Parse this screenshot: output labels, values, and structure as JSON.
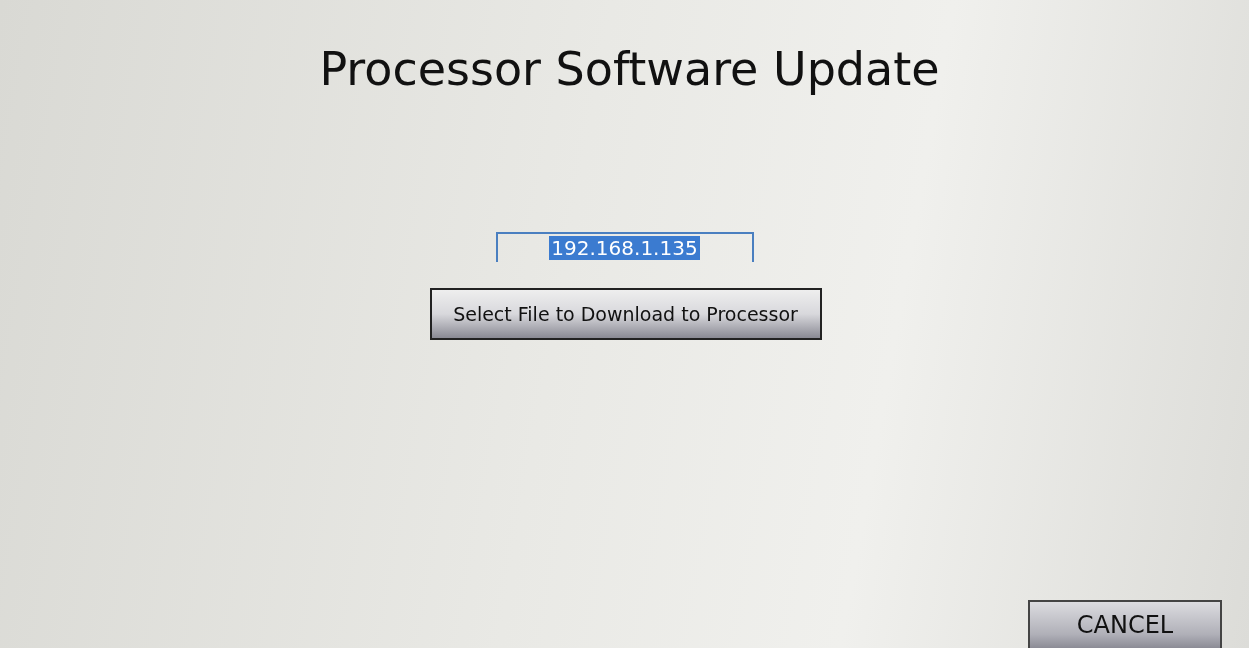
{
  "title": "Processor Software Update",
  "address_field": {
    "value": "192.168.1.135",
    "text_selected": true
  },
  "select_file_button": {
    "label": "Select File to Download to Processor"
  },
  "cancel_button": {
    "label": "CANCEL"
  }
}
